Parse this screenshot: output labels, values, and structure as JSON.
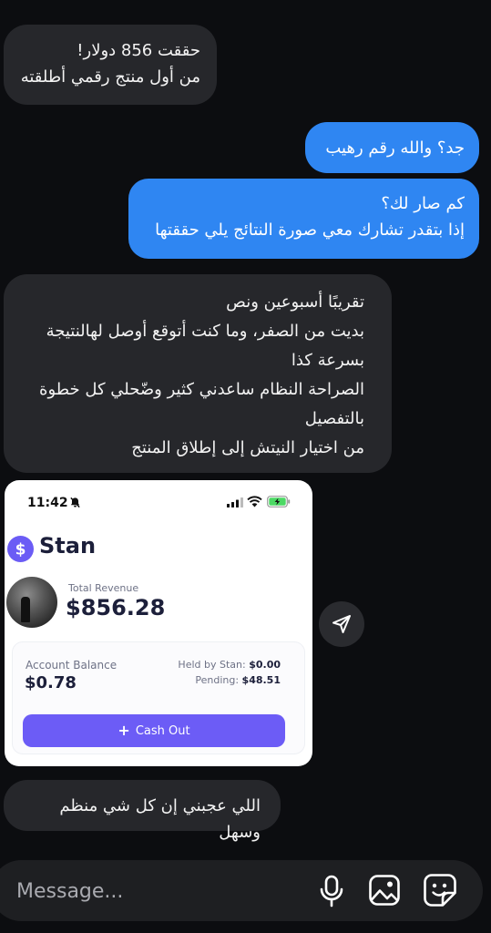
{
  "messages": [
    {
      "side": "received",
      "text": "حققت 856 دولار!\nمن أول منتج رقمي أطلقته"
    },
    {
      "side": "sent",
      "text": "جد؟ والله رقم رهيب"
    },
    {
      "side": "sent",
      "text": "كم صار لك؟\nإذا بتقدر تشارك معي صورة النتائج يلي حققتها"
    },
    {
      "side": "received",
      "text": "تقريبًا أسبوعين ونص\nبديت من الصفر، وما كنت أتوقع أوصل لهالنتيجة بسرعة كذا\nالصراحة النظام ساعدني كثير وضّحلي كل خطوة بالتفصيل\nمن اختيار النيتش إلى إطلاق المنتج"
    },
    {
      "side": "received",
      "text": "اللي عجبني إن كل شي منظم وسهل"
    }
  ],
  "shared_screenshot": {
    "status_time": "11:42",
    "brand": "Stan",
    "total_revenue_label": "Total Revenue",
    "total_revenue": "$856.28",
    "account_balance_label": "Account Balance",
    "account_balance": "$0.78",
    "held_label": "Held by Stan:",
    "held_value": "$0.00",
    "pending_label": "Pending:",
    "pending_value": "$48.51",
    "cash_out_label": "Cash Out",
    "brand_color": "#6c5cf6"
  },
  "composer": {
    "placeholder": "Message..."
  },
  "colors": {
    "background": "#0c0d10",
    "received_bubble": "#26272b",
    "sent_bubble": "#2f86f2"
  }
}
